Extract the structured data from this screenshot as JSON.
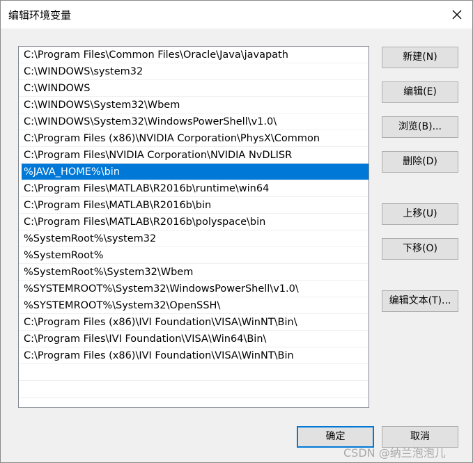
{
  "window": {
    "title": "编辑环境变量"
  },
  "list": {
    "items": [
      "C:\\Program Files\\Common Files\\Oracle\\Java\\javapath",
      "C:\\WINDOWS\\system32",
      "C:\\WINDOWS",
      "C:\\WINDOWS\\System32\\Wbem",
      "C:\\WINDOWS\\System32\\WindowsPowerShell\\v1.0\\",
      "C:\\Program Files (x86)\\NVIDIA Corporation\\PhysX\\Common",
      "C:\\Program Files\\NVIDIA Corporation\\NVIDIA NvDLISR",
      "%JAVA_HOME%\\bin",
      "C:\\Program Files\\MATLAB\\R2016b\\runtime\\win64",
      "C:\\Program Files\\MATLAB\\R2016b\\bin",
      "C:\\Program Files\\MATLAB\\R2016b\\polyspace\\bin",
      "%SystemRoot%\\system32",
      "%SystemRoot%",
      "%SystemRoot%\\System32\\Wbem",
      "%SYSTEMROOT%\\System32\\WindowsPowerShell\\v1.0\\",
      "%SYSTEMROOT%\\System32\\OpenSSH\\",
      "C:\\Program Files (x86)\\IVI Foundation\\VISA\\WinNT\\Bin\\",
      "C:\\Program Files\\IVI Foundation\\VISA\\Win64\\Bin\\",
      "C:\\Program Files (x86)\\IVI Foundation\\VISA\\WinNT\\Bin"
    ],
    "selected_index": 7
  },
  "buttons": {
    "new": "新建(N)",
    "edit": "编辑(E)",
    "browse": "浏览(B)...",
    "delete": "删除(D)",
    "move_up": "上移(U)",
    "move_down": "下移(O)",
    "edit_text": "编辑文本(T)...",
    "ok": "确定",
    "cancel": "取消"
  },
  "watermark": "CSDN @纳兰泡泡儿",
  "colors": {
    "selection": "#0078d7",
    "button_bg": "#e1e1e1",
    "window_bg": "#f0f0f0"
  },
  "icons": {
    "close": "close-icon"
  }
}
